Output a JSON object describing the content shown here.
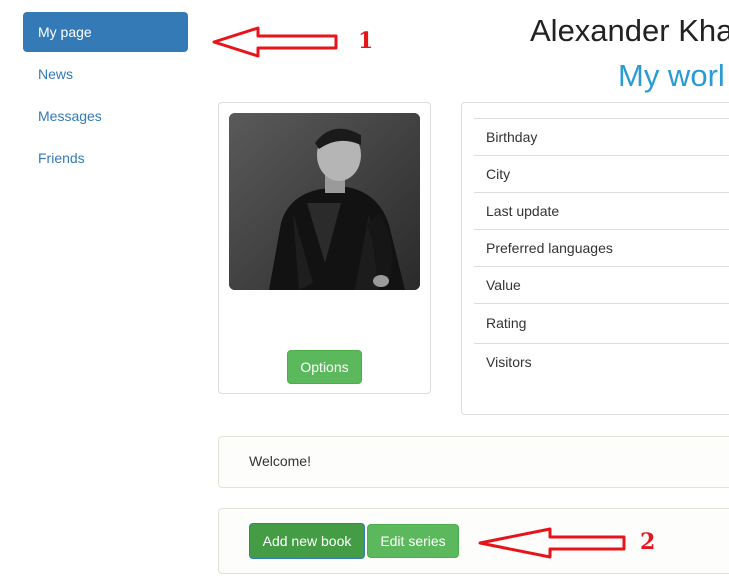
{
  "sidebar": {
    "items": [
      {
        "label": "My page",
        "active": true
      },
      {
        "label": "News"
      },
      {
        "label": "Messages"
      },
      {
        "label": "Friends"
      }
    ]
  },
  "header": {
    "user_name": "Alexander Kha",
    "world_title": "My worl"
  },
  "profile": {
    "options_label": "Options"
  },
  "info": {
    "rows": [
      "Birthday",
      "City",
      "Last update",
      "Preferred languages",
      "Value",
      "Rating",
      "Visitors"
    ]
  },
  "welcome": {
    "text": "Welcome!"
  },
  "actions": {
    "add_book_label": "Add new book",
    "edit_series_label": "Edit series"
  },
  "annotations": {
    "arrow1_label": "1",
    "arrow2_label": "2"
  },
  "colors": {
    "primary": "#337ab7",
    "success": "#5cb85c",
    "title_accent": "#2b9bd4",
    "annotation_red": "#e8141c"
  }
}
